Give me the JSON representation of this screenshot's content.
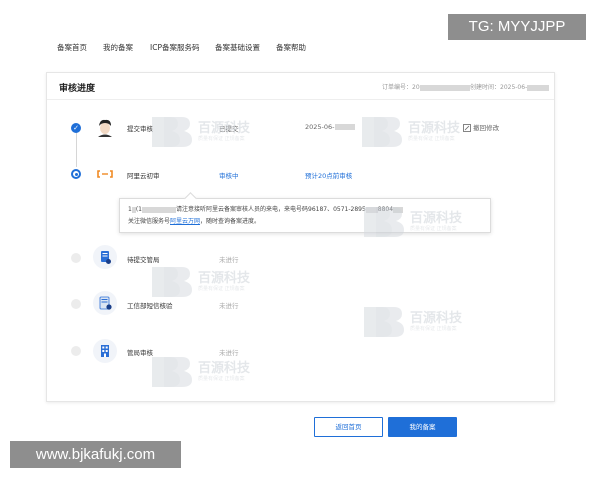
{
  "nav": {
    "items": [
      "备案首页",
      "我的备案",
      "ICP备案服务码",
      "备案基础设置",
      "备案帮助"
    ]
  },
  "badges": {
    "tg": "TG: MYYJJPP",
    "url": "www.bjkafukj.com"
  },
  "card": {
    "title": "审核进度",
    "order_label": "订单编号：20",
    "created_label": "创建时间：2025-06-"
  },
  "steps": [
    {
      "name": "提交审核",
      "status": "已提交",
      "extra": "2025-06-",
      "action": "撤回修改"
    },
    {
      "name": "阿里云初审",
      "status": "审核中",
      "extra": "预计20点前审核"
    },
    {
      "name": "待提交管局",
      "status": "未进行"
    },
    {
      "name": "工信部短信核验",
      "status": "未进行"
    },
    {
      "name": "管局审核",
      "status": "未进行"
    }
  ],
  "tooltip": {
    "line1_prefix": "1",
    "line1_mid": "(1",
    "line1_text": "请注意接听阿里云备案审核人员的来电，来电号码96187、0571-2895",
    "line1_end": "8804",
    "line2_prefix": "关注微信服务号",
    "line2_link": "阿里云万网",
    "line2_suffix": "，随时查询备案进度。"
  },
  "buttons": {
    "back": "返回首页",
    "mine": "我的备案"
  },
  "watermark": {
    "text": "百源科技",
    "sub": "质量有保证 正规备案"
  },
  "colors": {
    "accent": "#1f6fd8",
    "badge_bg": "#8e8e8e"
  }
}
